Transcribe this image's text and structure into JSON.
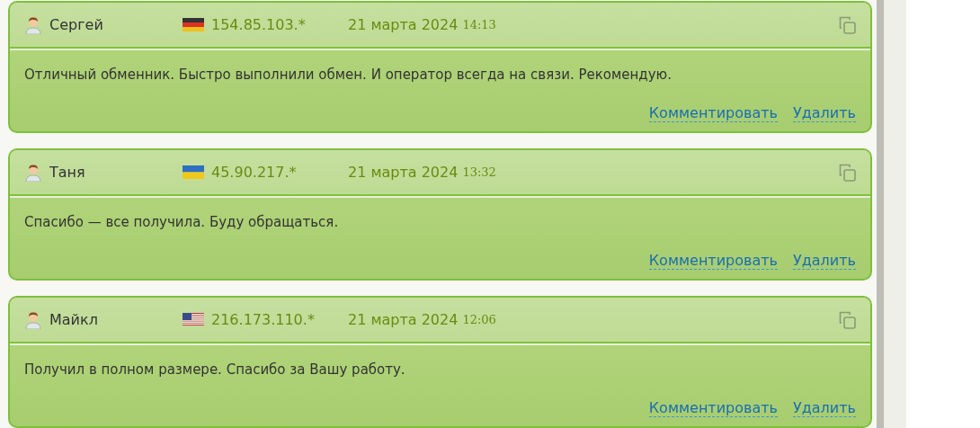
{
  "reviews": [
    {
      "author": "Сергей",
      "flag": {
        "kind": "de"
      },
      "ip": "154.85.103.*",
      "date": "21 марта 2024",
      "time": "14:13",
      "text": "Отличный обменник. Быстро выполнили обмен. И оператор всегда на связи. Рекомендую.",
      "actions": [
        "Комментировать",
        "Удалить"
      ]
    },
    {
      "author": "Таня",
      "flag": {
        "kind": "ua"
      },
      "ip": "45.90.217.*",
      "date": "21 марта 2024",
      "time": "13:32",
      "text": "Спасибо — все получила. Буду обращаться.",
      "actions": [
        "Комментировать",
        "Удалить"
      ]
    },
    {
      "author": "Майкл",
      "flag": {
        "kind": "us"
      },
      "ip": "216.173.110.*",
      "date": "21 марта 2024",
      "time": "12:06",
      "text": "Получил в полном размере. Спасибо за Вашу работу.",
      "actions": [
        "Комментировать",
        "Удалить"
      ]
    }
  ]
}
